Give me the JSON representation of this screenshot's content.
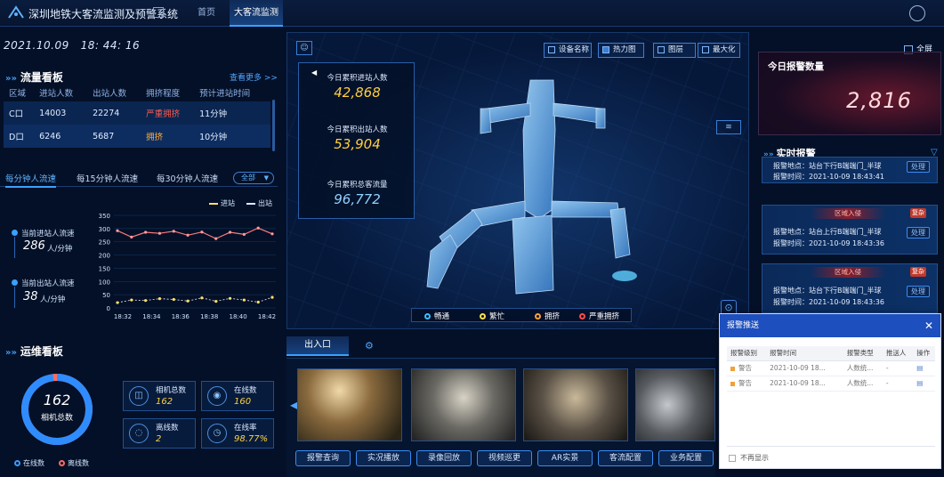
{
  "app": {
    "title": "深圳地铁大客流监测及预警系统"
  },
  "nav": {
    "tabs": [
      {
        "label": "首页"
      },
      {
        "label": "大客流监测"
      }
    ]
  },
  "datetime": {
    "date": "2021.10.09",
    "time": "18: 44: 16"
  },
  "flow_board": {
    "title": "流量看板",
    "more": "查看更多 >>",
    "columns": [
      "区域",
      "进站人数",
      "出站人数",
      "拥挤程度",
      "预计进站时间"
    ],
    "rows": [
      {
        "area": "C口",
        "in": "14003",
        "out": "22274",
        "level": "严重拥挤",
        "eta": "11分钟",
        "color": "#ff5a4e"
      },
      {
        "area": "D口",
        "in": "6246",
        "out": "5687",
        "level": "拥挤",
        "eta": "10分钟",
        "color": "#ffb13b"
      }
    ]
  },
  "flow_tabs": [
    {
      "label": "每分钟人流速"
    },
    {
      "label": "每15分钟人流速"
    },
    {
      "label": "每30分钟人流速"
    }
  ],
  "flow_filter": {
    "selected": "全部"
  },
  "speeds": {
    "in_label": "当前进站人流速",
    "in_value": "286",
    "in_unit": "人/分钟",
    "out_label": "当前出站人流速",
    "out_value": "38",
    "out_unit": "人/分钟"
  },
  "chart_data": {
    "type": "line",
    "x": [
      "18:32",
      "18:34",
      "18:36",
      "18:38",
      "18:40",
      "18:42"
    ],
    "ylim": [
      0,
      350
    ],
    "yticks": [
      0,
      50,
      100,
      150,
      200,
      250,
      300,
      350
    ],
    "series": [
      {
        "name": "进站",
        "color": "#ff6b6b",
        "values": [
          292,
          268,
          286,
          282,
          290,
          275,
          287,
          262,
          286,
          278,
          302,
          280
        ]
      },
      {
        "name": "出站",
        "color": "#ffe06b",
        "values": [
          20,
          30,
          28,
          35,
          32,
          26,
          38,
          25,
          36,
          30,
          22,
          40
        ]
      }
    ]
  },
  "ops_board": {
    "title": "运维看板",
    "total_value": "162",
    "total_label": "相机总数",
    "online_fraction": 0.98,
    "legend_online": "在线数",
    "legend_offline": "离线数",
    "stats": [
      {
        "label": "相机总数",
        "value": "162",
        "icon": "camera-icon"
      },
      {
        "label": "在线数",
        "value": "160",
        "icon": "online-icon"
      },
      {
        "label": "离线数",
        "value": "2",
        "icon": "offline-icon"
      },
      {
        "label": "在线率",
        "value": "98.77%",
        "icon": "clock-icon"
      }
    ]
  },
  "center": {
    "today_in_label": "今日累积进站人数",
    "today_in_value": "42,868",
    "today_out_label": "今日累积出站人数",
    "today_out_value": "53,904",
    "today_total_label": "今日累积总客流量",
    "today_total_value": "96,772",
    "view_buttons": [
      {
        "label": "设备名称"
      },
      {
        "label": "热力图"
      },
      {
        "label": "图层"
      },
      {
        "label": "最大化"
      }
    ],
    "legend": [
      {
        "label": "畅通",
        "color": "#3ac0ff"
      },
      {
        "label": "繁忙",
        "color": "#ffe14f"
      },
      {
        "label": "拥挤",
        "color": "#ffa23a"
      },
      {
        "label": "严重拥挤",
        "color": "#ff4c4c"
      }
    ]
  },
  "entrance": {
    "tab": "出入口",
    "buttons": [
      "报警查询",
      "实况播放",
      "录像回放",
      "视频巡更",
      "AR实景",
      "客流配置",
      "业务配置"
    ]
  },
  "fullscreen": {
    "label": "全屏"
  },
  "today_alarm": {
    "title": "今日报警数量",
    "value": "2,816"
  },
  "realtime": {
    "title": "实时报警",
    "items": [
      {
        "place": "报警地点：站台下行B端端门_半球",
        "time": "报警时间：2021-10-09 18:43:41",
        "type": "",
        "tag": "",
        "action": "处理"
      },
      {
        "place": "报警地点：站台上行B端端门_半球",
        "time": "报警时间：2021-10-09 18:43:36",
        "type": "区域入侵",
        "tag": "复杂",
        "action": "处理"
      },
      {
        "place": "报警地点：站台下行B端端门_半球",
        "time": "报警时间：2021-10-09 18:43:36",
        "type": "区域入侵",
        "tag": "复杂",
        "action": "处理"
      }
    ]
  },
  "popup": {
    "title": "报警推送",
    "columns": [
      "报警级别",
      "报警时间",
      "报警类型",
      "推送人",
      "操作"
    ],
    "rows": [
      {
        "level": "警告",
        "time": "2021-10-09 18...",
        "type": "人数统...",
        "who": "-"
      },
      {
        "level": "警告",
        "time": "2021-10-09 18...",
        "type": "人数统...",
        "who": "-"
      }
    ],
    "no_show": "不再显示"
  }
}
